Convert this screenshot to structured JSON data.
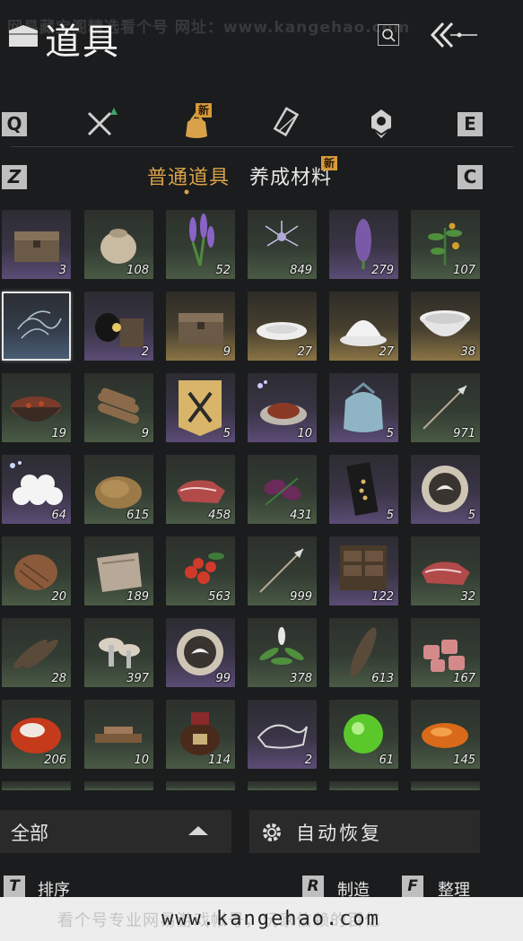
{
  "watermark": {
    "top": "网易藏宝阁精选看个号  网址：www.kangehao.com",
    "bottom": "www.kangehao.com",
    "bottom_ghost": "看个号专业网易游戏帐号，玩家信赖的百亿"
  },
  "header": {
    "title": "道具"
  },
  "tabs": {
    "key_left": "Q",
    "key_right": "E",
    "items": [
      {
        "icon": "crossed-swords-icon"
      },
      {
        "icon": "pouch-icon",
        "badge": "新",
        "active": true
      },
      {
        "icon": "scroll-icon"
      },
      {
        "icon": "emblem-icon"
      }
    ]
  },
  "subtabs": {
    "key_left": "Z",
    "key_right": "C",
    "items": [
      {
        "label": "普通道具",
        "active": true
      },
      {
        "label": "养成材料",
        "badge": "新"
      }
    ]
  },
  "items": [
    {
      "name": "chest",
      "qty": "3",
      "rarity": "purple"
    },
    {
      "name": "grain-sack",
      "qty": "108",
      "rarity": "green"
    },
    {
      "name": "lavender",
      "qty": "52",
      "rarity": "green"
    },
    {
      "name": "spider-lily",
      "qty": "849",
      "rarity": "green"
    },
    {
      "name": "purple-flower-spike",
      "qty": "279",
      "rarity": "purple"
    },
    {
      "name": "herb-berries",
      "qty": "107",
      "rarity": "green"
    },
    {
      "name": "wind-spirit",
      "qty": "",
      "rarity": "blue",
      "selected": true
    },
    {
      "name": "black-bag-box",
      "qty": "2",
      "rarity": "purple"
    },
    {
      "name": "chest",
      "qty": "9",
      "rarity": "gold"
    },
    {
      "name": "plate",
      "qty": "27",
      "rarity": "gold"
    },
    {
      "name": "bowl-lid",
      "qty": "27",
      "rarity": "gold"
    },
    {
      "name": "porcelain-bowl",
      "qty": "38",
      "rarity": "gold"
    },
    {
      "name": "stew-bowl",
      "qty": "19",
      "rarity": "green"
    },
    {
      "name": "firewood",
      "qty": "9",
      "rarity": "green"
    },
    {
      "name": "swords-banner",
      "qty": "5",
      "rarity": "purple"
    },
    {
      "name": "meat-dish",
      "qty": "10",
      "rarity": "purple"
    },
    {
      "name": "silk-pouch",
      "qty": "5",
      "rarity": "purple"
    },
    {
      "name": "arrow",
      "qty": "971",
      "rarity": "green"
    },
    {
      "name": "dumplings",
      "qty": "64",
      "rarity": "purple"
    },
    {
      "name": "tea-leaves",
      "qty": "615",
      "rarity": "green"
    },
    {
      "name": "raw-meat",
      "qty": "458",
      "rarity": "green"
    },
    {
      "name": "purple-petals",
      "qty": "431",
      "rarity": "green"
    },
    {
      "name": "gold-scroll",
      "qty": "5",
      "rarity": "purple"
    },
    {
      "name": "crane-token",
      "qty": "5",
      "rarity": "purple"
    },
    {
      "name": "comb",
      "qty": "20",
      "rarity": "green"
    },
    {
      "name": "fur-pelt",
      "qty": "189",
      "rarity": "green"
    },
    {
      "name": "red-berries",
      "qty": "563",
      "rarity": "green"
    },
    {
      "name": "arrow",
      "qty": "999",
      "rarity": "green"
    },
    {
      "name": "drawer-cabinet",
      "qty": "122",
      "rarity": "purple"
    },
    {
      "name": "raw-meat",
      "qty": "32",
      "rarity": "green"
    },
    {
      "name": "feathers",
      "qty": "28",
      "rarity": "green"
    },
    {
      "name": "mushrooms",
      "qty": "397",
      "rarity": "green"
    },
    {
      "name": "crane-token",
      "qty": "99",
      "rarity": "purple"
    },
    {
      "name": "white-herb",
      "qty": "378",
      "rarity": "green"
    },
    {
      "name": "brown-feather",
      "qty": "613",
      "rarity": "green"
    },
    {
      "name": "meat-chunks",
      "qty": "167",
      "rarity": "green"
    },
    {
      "name": "red-stone",
      "qty": "206",
      "rarity": "green"
    },
    {
      "name": "wood-tray",
      "qty": "10",
      "rarity": "green"
    },
    {
      "name": "wine-jar",
      "qty": "114",
      "rarity": "green"
    },
    {
      "name": "silver-dragon",
      "qty": "2",
      "rarity": "purple"
    },
    {
      "name": "green-orb",
      "qty": "61",
      "rarity": "green"
    },
    {
      "name": "amber-stone",
      "qty": "145",
      "rarity": "green"
    }
  ],
  "bottom": {
    "filter_label": "全部",
    "auto_recover_label": "自动恢复",
    "hotkeys": [
      {
        "key": "T",
        "label": "排序"
      },
      {
        "key": "R",
        "label": "制造"
      },
      {
        "key": "F",
        "label": "整理"
      }
    ]
  },
  "colors": {
    "accent": "#d89a3a",
    "active_tab": "#d9a24a",
    "background": "#1b1c1d"
  }
}
